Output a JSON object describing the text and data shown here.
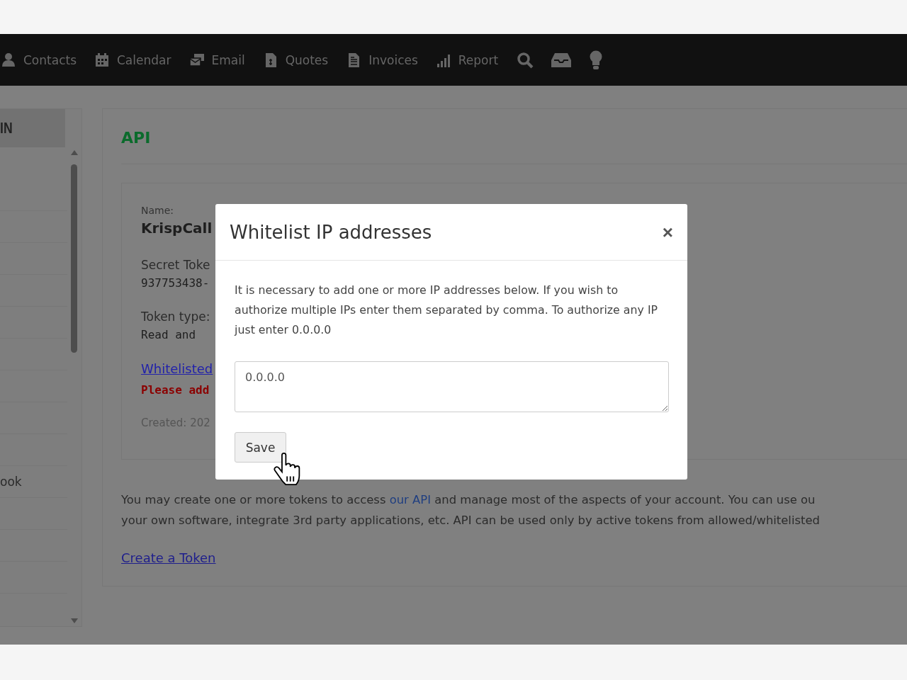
{
  "nav": {
    "items": [
      {
        "label": "Contacts"
      },
      {
        "label": "Calendar"
      },
      {
        "label": "Email"
      },
      {
        "label": "Quotes"
      },
      {
        "label": "Invoices"
      },
      {
        "label": "Report"
      }
    ]
  },
  "sidebar": {
    "title": "IN",
    "items": [
      "ook"
    ]
  },
  "api": {
    "title": "API",
    "token": {
      "name_label": "Name:",
      "name": "KrispCall",
      "secret_label": "Secret Toke",
      "secret": "937753438-",
      "type_label": "Token type:",
      "type": "Read and",
      "whitelist_link": "Whitelisted",
      "warning": "Please add",
      "created": "Created: 202"
    },
    "intro": {
      "before": "You may create one or more tokens to access",
      "link": "our API",
      "after": "and manage most of the aspects of your account. You can use ou",
      "line_2": "your own software, integrate 3rd party applications, etc. API can be used only by active tokens from allowed/whitelisted"
    },
    "create_link": "Create a Token"
  },
  "dialog": {
    "title": "Whitelist IP addresses",
    "close": "×",
    "message": "It is necessary to add one or more IP addresses below. If you wish to authorize multiple IPs enter them separated by comma. To authorize any IP just enter 0.0.0.0",
    "ip_field": {
      "value": "0.0.0.0"
    },
    "save": "Save"
  }
}
